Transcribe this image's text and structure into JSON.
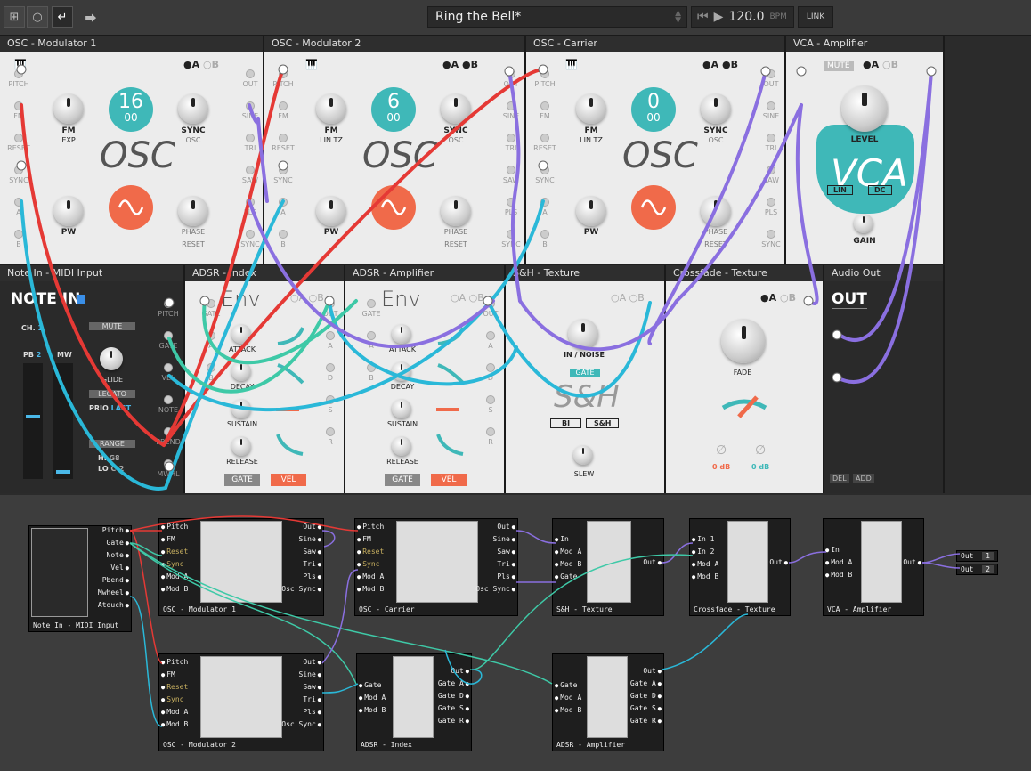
{
  "toolbar": {
    "preset_name": "Ring the Bell*",
    "tempo": "120.0",
    "tempo_unit": "BPM",
    "link_label": "LINK",
    "icons": [
      "grid-icon",
      "circle-icon",
      "return-icon",
      "share-icon"
    ]
  },
  "modules": {
    "osc_mod1": {
      "title": "OSC - Modulator 1",
      "value_top": "16",
      "value_bottom": "00",
      "fm": "FM",
      "fm_sub": "EXP",
      "sync": "SYNC",
      "sync_sub": "OSC",
      "pw": "PW",
      "phase": "PHASE",
      "phase_sub": "RESET",
      "osc": "OSC",
      "a": "A",
      "b": "B"
    },
    "osc_mod2": {
      "title": "OSC - Modulator 2",
      "value_top": "6",
      "value_bottom": "00",
      "fm": "FM",
      "fm_sub": "LIN TZ",
      "sync": "SYNC",
      "sync_sub": "OSC",
      "pw": "PW",
      "phase": "PHASE",
      "phase_sub": "RESET",
      "osc": "OSC",
      "a": "A",
      "b": "B"
    },
    "osc_carrier": {
      "title": "OSC - Carrier",
      "value_top": "0",
      "value_bottom": "00",
      "fm": "FM",
      "fm_sub": "LIN TZ",
      "sync": "SYNC",
      "sync_sub": "OSC",
      "pw": "PW",
      "phase": "PHASE",
      "phase_sub": "RESET",
      "osc": "OSC",
      "a": "A",
      "b": "B"
    },
    "vca": {
      "title": "VCA - Amplifier",
      "mute": "MUTE",
      "level": "LEVEL",
      "big": "VCA",
      "lin": "LIN",
      "dc": "DC",
      "gain": "GAIN",
      "a": "A",
      "b": "B"
    },
    "note_in": {
      "title": "Note In - MIDI Input",
      "big": "NOTE IN",
      "ch_label": "CH.",
      "ch": "1",
      "mute": "MUTE",
      "pb_label": "PB",
      "pb": "2",
      "mw": "MW",
      "glide": "GLIDE",
      "legato": "LEGATO",
      "prio_label": "PRIO",
      "prio": "LAST",
      "range": "RANGE",
      "hi_label": "HI",
      "hi": "G8",
      "lo_label": "LO",
      "lo": "C-2"
    },
    "adsr_index": {
      "title": "ADSR - Index",
      "big": "Env",
      "attack": "ATTACK",
      "decay": "DECAY",
      "sustain": "SUSTAIN",
      "release": "RELEASE",
      "gate": "GATE",
      "vel": "VEL",
      "a": "A",
      "b": "B"
    },
    "adsr_amp": {
      "title": "ADSR - Amplifier",
      "big": "Env",
      "attack": "ATTACK",
      "decay": "DECAY",
      "sustain": "SUSTAIN",
      "release": "RELEASE",
      "gate": "GATE",
      "vel": "VEL",
      "a": "A",
      "b": "B"
    },
    "sh": {
      "title": "S&H - Texture",
      "in_noise": "IN / NOISE",
      "gate": "GATE",
      "big": "S&H",
      "bi": "BI",
      "sh_btn": "S&H",
      "slew": "SLEW",
      "a": "A",
      "b": "B"
    },
    "xfade": {
      "title": "Crossfade - Texture",
      "fade": "FADE",
      "db1": "0 dB",
      "db2": "0 dB",
      "a": "A",
      "b": "B"
    },
    "audio_out": {
      "title": "Audio Out",
      "big": "OUT",
      "del": "DEL",
      "add": "ADD"
    }
  },
  "osc_ports_left": [
    "PITCH",
    "FM",
    "RESET",
    "SYNC",
    "A",
    "B"
  ],
  "osc_ports_right": [
    "OUT",
    "SINE",
    "TRI",
    "SAW",
    "PLS",
    "SYNC"
  ],
  "note_ports": [
    "PITCH",
    "GATE",
    "VEL",
    "NOTE",
    "PBEND",
    "MWHL"
  ],
  "adsr_ports_left": [
    "GATE",
    "A",
    "B"
  ],
  "adsr_ports_right": [
    "OUT",
    "A",
    "D",
    "S",
    "R"
  ],
  "graph": {
    "note_in": {
      "name": "Note In - MIDI Input",
      "outs": [
        "Pitch",
        "Gate",
        "Note",
        "Vel",
        "Pbend",
        "Mwheel",
        "Atouch"
      ]
    },
    "osc_mod1": {
      "name": "OSC - Modulator 1",
      "ins": [
        "Pitch",
        "FM",
        "Reset",
        "Sync",
        "Mod A",
        "Mod B"
      ],
      "outs": [
        "Out",
        "Sine",
        "Saw",
        "Tri",
        "Pls",
        "Osc Sync"
      ]
    },
    "osc_carrier": {
      "name": "OSC - Carrier",
      "ins": [
        "Pitch",
        "FM",
        "Reset",
        "Sync",
        "Mod A",
        "Mod B"
      ],
      "outs": [
        "Out",
        "Sine",
        "Saw",
        "Tri",
        "Pls",
        "Osc Sync"
      ]
    },
    "sh": {
      "name": "S&H - Texture",
      "ins": [
        "In",
        "Mod A",
        "Mod B",
        "Gate"
      ],
      "outs": [
        "Out"
      ]
    },
    "xfade": {
      "name": "Crossfade - Texture",
      "ins": [
        "In 1",
        "In 2",
        "Mod A",
        "Mod B"
      ],
      "outs": [
        "Out"
      ]
    },
    "vca": {
      "name": "VCA - Amplifier",
      "ins": [
        "In",
        "Mod A",
        "Mod B"
      ],
      "outs": [
        "Out"
      ]
    },
    "osc_mod2": {
      "name": "OSC - Modulator 2",
      "ins": [
        "Pitch",
        "FM",
        "Reset",
        "Sync",
        "Mod A",
        "Mod B"
      ],
      "outs": [
        "Out",
        "Sine",
        "Saw",
        "Tri",
        "Pls",
        "Osc Sync"
      ]
    },
    "adsr_index": {
      "name": "ADSR - Index",
      "ins": [
        "Gate",
        "Mod A",
        "Mod B"
      ],
      "outs": [
        "Out",
        "Gate A",
        "Gate D",
        "Gate S",
        "Gate R"
      ]
    },
    "adsr_amp": {
      "name": "ADSR - Amplifier",
      "ins": [
        "Gate",
        "Mod A",
        "Mod B"
      ],
      "outs": [
        "Out",
        "Gate A",
        "Gate D",
        "Gate S",
        "Gate R"
      ]
    },
    "audio_out": [
      {
        "label": "Out",
        "num": "1"
      },
      {
        "label": "Out",
        "num": "2"
      }
    ]
  },
  "colors": {
    "teal": "#3fb8b8",
    "orange": "#f06a4a",
    "red": "#e53935",
    "purple": "#8a6fe0",
    "cyan": "#2ab8d8",
    "green": "#3ec9a7"
  }
}
